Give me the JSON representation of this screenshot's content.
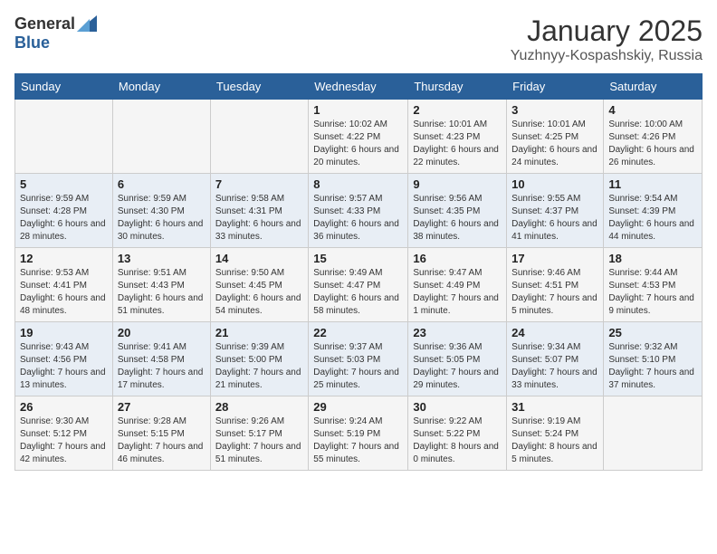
{
  "logo": {
    "general": "General",
    "blue": "Blue"
  },
  "title": "January 2025",
  "subtitle": "Yuzhnyy-Kospashskiy, Russia",
  "weekdays": [
    "Sunday",
    "Monday",
    "Tuesday",
    "Wednesday",
    "Thursday",
    "Friday",
    "Saturday"
  ],
  "weeks": [
    [
      {
        "day": "",
        "info": ""
      },
      {
        "day": "",
        "info": ""
      },
      {
        "day": "",
        "info": ""
      },
      {
        "day": "1",
        "info": "Sunrise: 10:02 AM\nSunset: 4:22 PM\nDaylight: 6 hours and 20 minutes."
      },
      {
        "day": "2",
        "info": "Sunrise: 10:01 AM\nSunset: 4:23 PM\nDaylight: 6 hours and 22 minutes."
      },
      {
        "day": "3",
        "info": "Sunrise: 10:01 AM\nSunset: 4:25 PM\nDaylight: 6 hours and 24 minutes."
      },
      {
        "day": "4",
        "info": "Sunrise: 10:00 AM\nSunset: 4:26 PM\nDaylight: 6 hours and 26 minutes."
      }
    ],
    [
      {
        "day": "5",
        "info": "Sunrise: 9:59 AM\nSunset: 4:28 PM\nDaylight: 6 hours and 28 minutes."
      },
      {
        "day": "6",
        "info": "Sunrise: 9:59 AM\nSunset: 4:30 PM\nDaylight: 6 hours and 30 minutes."
      },
      {
        "day": "7",
        "info": "Sunrise: 9:58 AM\nSunset: 4:31 PM\nDaylight: 6 hours and 33 minutes."
      },
      {
        "day": "8",
        "info": "Sunrise: 9:57 AM\nSunset: 4:33 PM\nDaylight: 6 hours and 36 minutes."
      },
      {
        "day": "9",
        "info": "Sunrise: 9:56 AM\nSunset: 4:35 PM\nDaylight: 6 hours and 38 minutes."
      },
      {
        "day": "10",
        "info": "Sunrise: 9:55 AM\nSunset: 4:37 PM\nDaylight: 6 hours and 41 minutes."
      },
      {
        "day": "11",
        "info": "Sunrise: 9:54 AM\nSunset: 4:39 PM\nDaylight: 6 hours and 44 minutes."
      }
    ],
    [
      {
        "day": "12",
        "info": "Sunrise: 9:53 AM\nSunset: 4:41 PM\nDaylight: 6 hours and 48 minutes."
      },
      {
        "day": "13",
        "info": "Sunrise: 9:51 AM\nSunset: 4:43 PM\nDaylight: 6 hours and 51 minutes."
      },
      {
        "day": "14",
        "info": "Sunrise: 9:50 AM\nSunset: 4:45 PM\nDaylight: 6 hours and 54 minutes."
      },
      {
        "day": "15",
        "info": "Sunrise: 9:49 AM\nSunset: 4:47 PM\nDaylight: 6 hours and 58 minutes."
      },
      {
        "day": "16",
        "info": "Sunrise: 9:47 AM\nSunset: 4:49 PM\nDaylight: 7 hours and 1 minute."
      },
      {
        "day": "17",
        "info": "Sunrise: 9:46 AM\nSunset: 4:51 PM\nDaylight: 7 hours and 5 minutes."
      },
      {
        "day": "18",
        "info": "Sunrise: 9:44 AM\nSunset: 4:53 PM\nDaylight: 7 hours and 9 minutes."
      }
    ],
    [
      {
        "day": "19",
        "info": "Sunrise: 9:43 AM\nSunset: 4:56 PM\nDaylight: 7 hours and 13 minutes."
      },
      {
        "day": "20",
        "info": "Sunrise: 9:41 AM\nSunset: 4:58 PM\nDaylight: 7 hours and 17 minutes."
      },
      {
        "day": "21",
        "info": "Sunrise: 9:39 AM\nSunset: 5:00 PM\nDaylight: 7 hours and 21 minutes."
      },
      {
        "day": "22",
        "info": "Sunrise: 9:37 AM\nSunset: 5:03 PM\nDaylight: 7 hours and 25 minutes."
      },
      {
        "day": "23",
        "info": "Sunrise: 9:36 AM\nSunset: 5:05 PM\nDaylight: 7 hours and 29 minutes."
      },
      {
        "day": "24",
        "info": "Sunrise: 9:34 AM\nSunset: 5:07 PM\nDaylight: 7 hours and 33 minutes."
      },
      {
        "day": "25",
        "info": "Sunrise: 9:32 AM\nSunset: 5:10 PM\nDaylight: 7 hours and 37 minutes."
      }
    ],
    [
      {
        "day": "26",
        "info": "Sunrise: 9:30 AM\nSunset: 5:12 PM\nDaylight: 7 hours and 42 minutes."
      },
      {
        "day": "27",
        "info": "Sunrise: 9:28 AM\nSunset: 5:15 PM\nDaylight: 7 hours and 46 minutes."
      },
      {
        "day": "28",
        "info": "Sunrise: 9:26 AM\nSunset: 5:17 PM\nDaylight: 7 hours and 51 minutes."
      },
      {
        "day": "29",
        "info": "Sunrise: 9:24 AM\nSunset: 5:19 PM\nDaylight: 7 hours and 55 minutes."
      },
      {
        "day": "30",
        "info": "Sunrise: 9:22 AM\nSunset: 5:22 PM\nDaylight: 8 hours and 0 minutes."
      },
      {
        "day": "31",
        "info": "Sunrise: 9:19 AM\nSunset: 5:24 PM\nDaylight: 8 hours and 5 minutes."
      },
      {
        "day": "",
        "info": ""
      }
    ]
  ]
}
